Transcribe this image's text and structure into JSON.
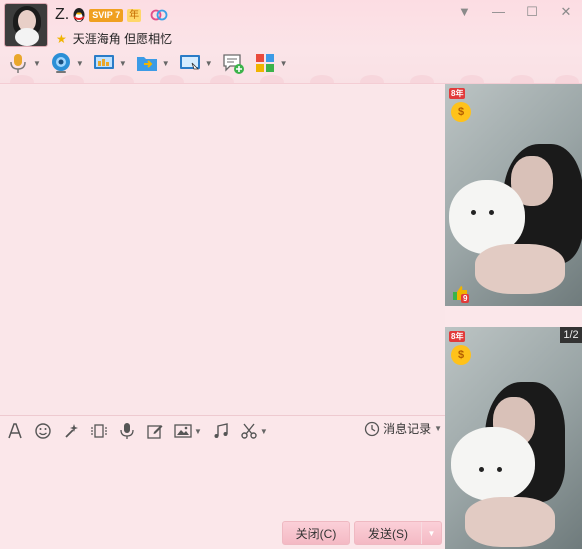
{
  "header": {
    "name": "Z.",
    "vip_badge": "SVIP 7",
    "year_badge": "年",
    "signature": "天涯海角 但愿相忆",
    "window_controls": [
      "▼",
      "—",
      "☐",
      "✕"
    ]
  },
  "toolbar": {
    "tools": [
      "microphone-icon",
      "video-camera-icon",
      "screen-share-icon",
      "file-transfer-icon",
      "remote-desktop-icon",
      "message-add-icon",
      "apps-icon"
    ]
  },
  "input_toolbar": {
    "history_label": "消息记录"
  },
  "buttons": {
    "close_label": "关闭(C)",
    "send_label": "发送(S)"
  },
  "right_panel": {
    "badge_label": "8年",
    "coin_label": "$",
    "thumb_count": "9",
    "page_indicator": "1/2"
  }
}
